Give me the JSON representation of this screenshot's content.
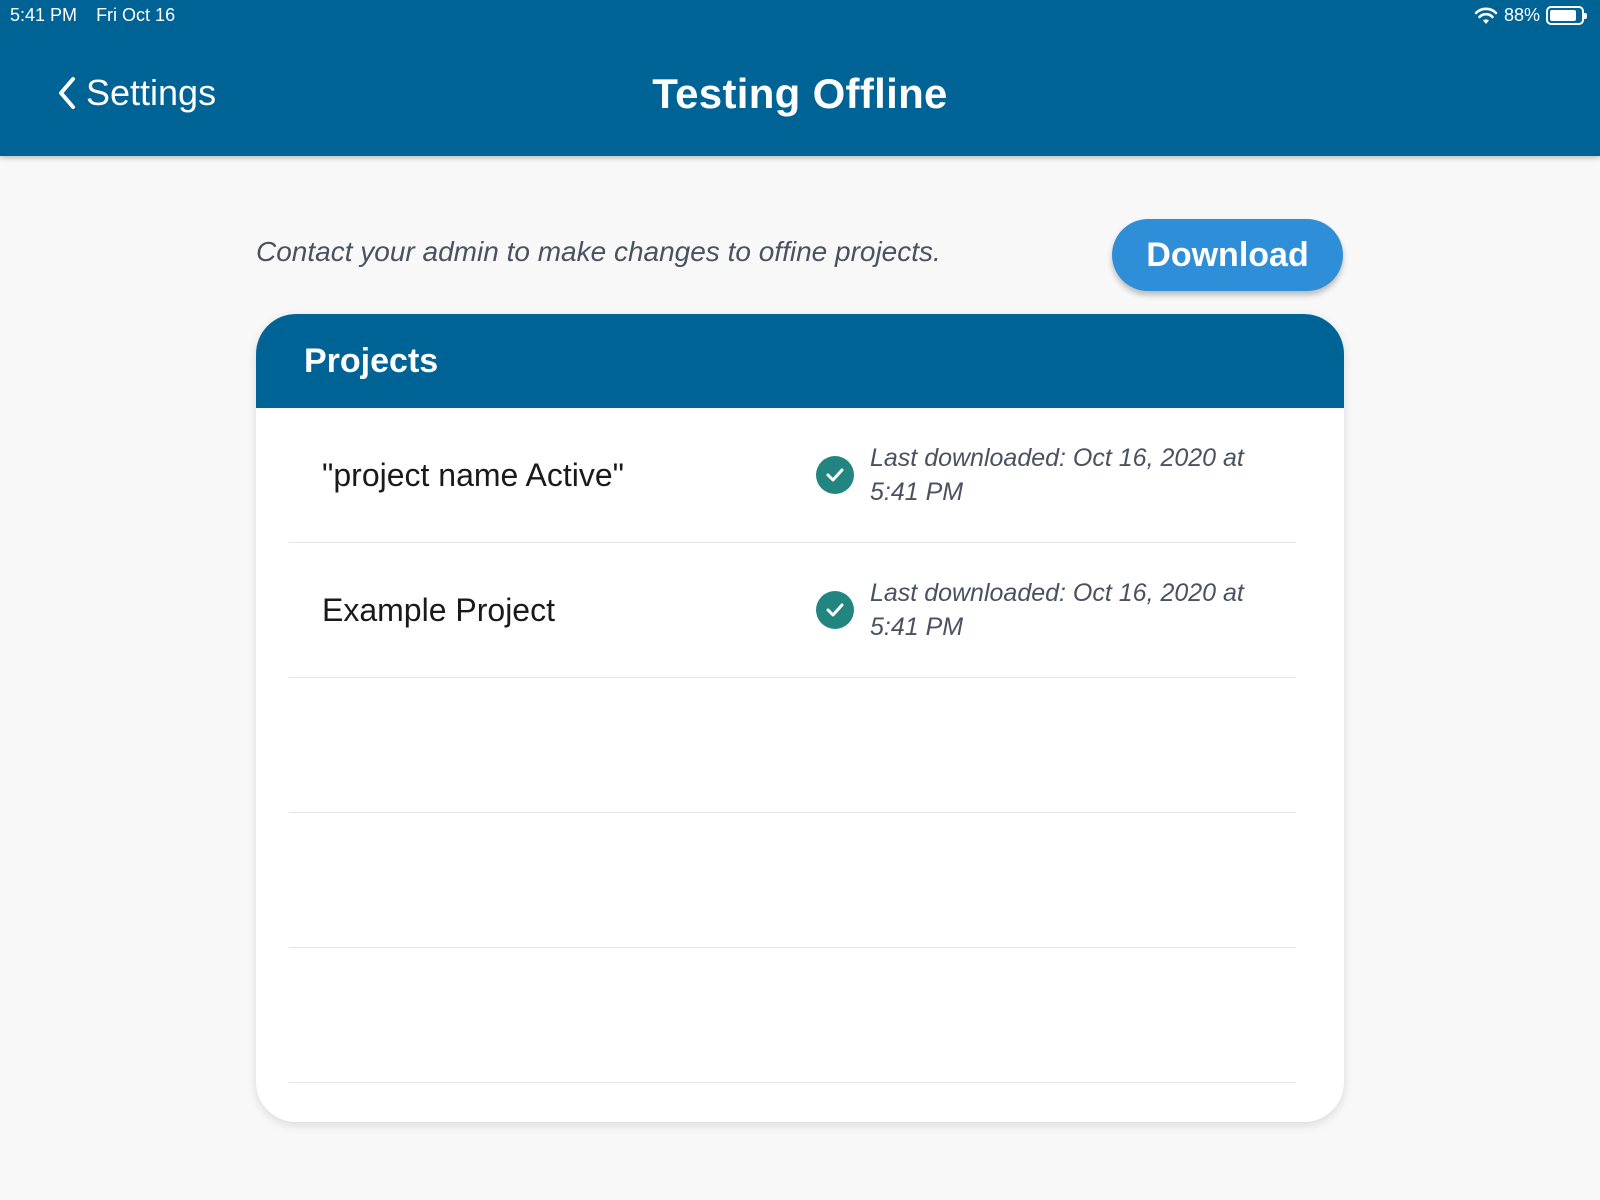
{
  "status_bar": {
    "time": "5:41 PM",
    "date": "Fri Oct 16",
    "battery": "88%",
    "battery_level": 0.88
  },
  "nav": {
    "back_label": "Settings",
    "title": "Testing Offline"
  },
  "notice": "Contact your admin to make changes to offine projects.",
  "download_label": "Download",
  "projects": {
    "header": "Projects",
    "items": [
      {
        "name": "\"project name Active\"",
        "status": "Last downloaded: Oct 16, 2020 at 5:41 PM"
      },
      {
        "name": "Example Project",
        "status": "Last downloaded: Oct 16, 2020 at 5:41 PM"
      }
    ]
  },
  "colors": {
    "primary": "#006396",
    "button": "#2e8ed8",
    "check": "#228580"
  }
}
